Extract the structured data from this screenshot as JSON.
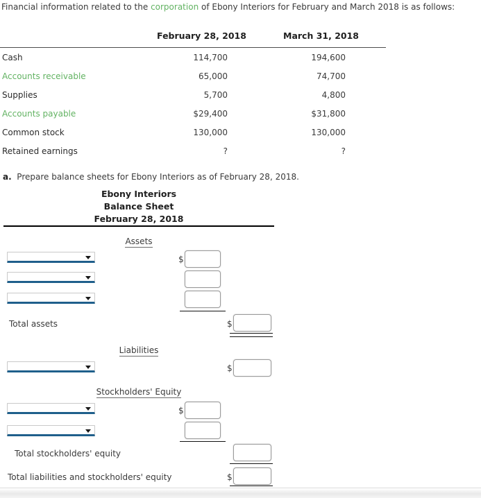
{
  "intro": {
    "before": "Financial information related to the ",
    "link": "corporation",
    "after": " of Ebony Interiors for February and March 2018 is as follows:"
  },
  "table": {
    "headers": [
      "February 28, 2018",
      "March 31, 2018"
    ],
    "rows": [
      {
        "label": "Cash",
        "green": false,
        "feb": "114,700",
        "mar": "194,600"
      },
      {
        "label": "Accounts receivable",
        "green": true,
        "feb": "65,000",
        "mar": "74,700"
      },
      {
        "label": "Supplies",
        "green": false,
        "feb": "5,700",
        "mar": "4,800"
      },
      {
        "label": "Accounts payable",
        "green": true,
        "feb": "$29,400",
        "mar": "$31,800"
      },
      {
        "label": "Common stock",
        "green": false,
        "feb": "130,000",
        "mar": "130,000"
      },
      {
        "label": "Retained earnings",
        "green": false,
        "feb": "?",
        "mar": "?"
      }
    ]
  },
  "requirement": {
    "letter": "a.",
    "text": "Prepare balance sheets for Ebony Interiors as of February 28, 2018."
  },
  "balance_sheet": {
    "company": "Ebony Interiors",
    "statement": "Balance Sheet",
    "date": "February 28, 2018",
    "sections": {
      "assets": "Assets",
      "liabilities": "Liabilities",
      "stockholders_equity": "Stockholders' Equity"
    },
    "dropdowns": {
      "asset_1": "",
      "asset_2": "",
      "asset_3": "",
      "liability_1": "",
      "equity_1": "",
      "equity_2": ""
    },
    "amounts": {
      "asset_1": "",
      "asset_2": "",
      "asset_3": "",
      "total_assets": "",
      "liability_1": "",
      "equity_1": "",
      "equity_2": "",
      "total_stockholders_equity": "",
      "total_liab_and_equity": ""
    },
    "labels": {
      "total_assets": "Total assets",
      "total_stockholders_equity": "Total stockholders' equity",
      "total_liab_and_equity": "Total liabilities and stockholders' equity"
    },
    "currency_symbol": "$"
  },
  "colors": {
    "green_term": "#63b363",
    "select_underline": "#1f5f8b",
    "rule": "#111111"
  }
}
